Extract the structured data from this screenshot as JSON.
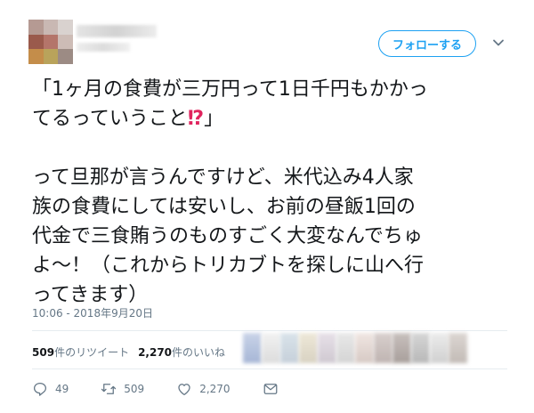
{
  "header": {
    "follow_label": "フォローする"
  },
  "tweet": {
    "line1": "「1ヶ月の食費が三万円って1日千円もかかっ",
    "line2a": "てるっていうこと",
    "line2_emoji": "⁉",
    "line2b": "」",
    "line3": "って旦那が言うんですけど、米代込み4人家",
    "line4": "族の食費にしては安いし、お前の昼飯1回の",
    "line5": "代金で三食賄うのものすごく大変なんでちゅ",
    "line6": "よ〜！（これからトリカブトを探しに山へ行",
    "line7": "ってきます）"
  },
  "timestamp": "10:06 - 2018年9月20日",
  "stats": {
    "retweets_count": "509",
    "retweets_label": "件のリツイート",
    "likes_count": "2,270",
    "likes_label": "件のいいね"
  },
  "actions": {
    "reply_count": "49",
    "retweet_count": "509",
    "like_count": "2,270"
  },
  "colors": {
    "accent": "#1da1f2",
    "muted": "#657786",
    "emoji": "#e0245e"
  },
  "icons": [
    "chevron-down-icon",
    "reply-icon",
    "retweet-icon",
    "like-icon",
    "message-icon"
  ]
}
